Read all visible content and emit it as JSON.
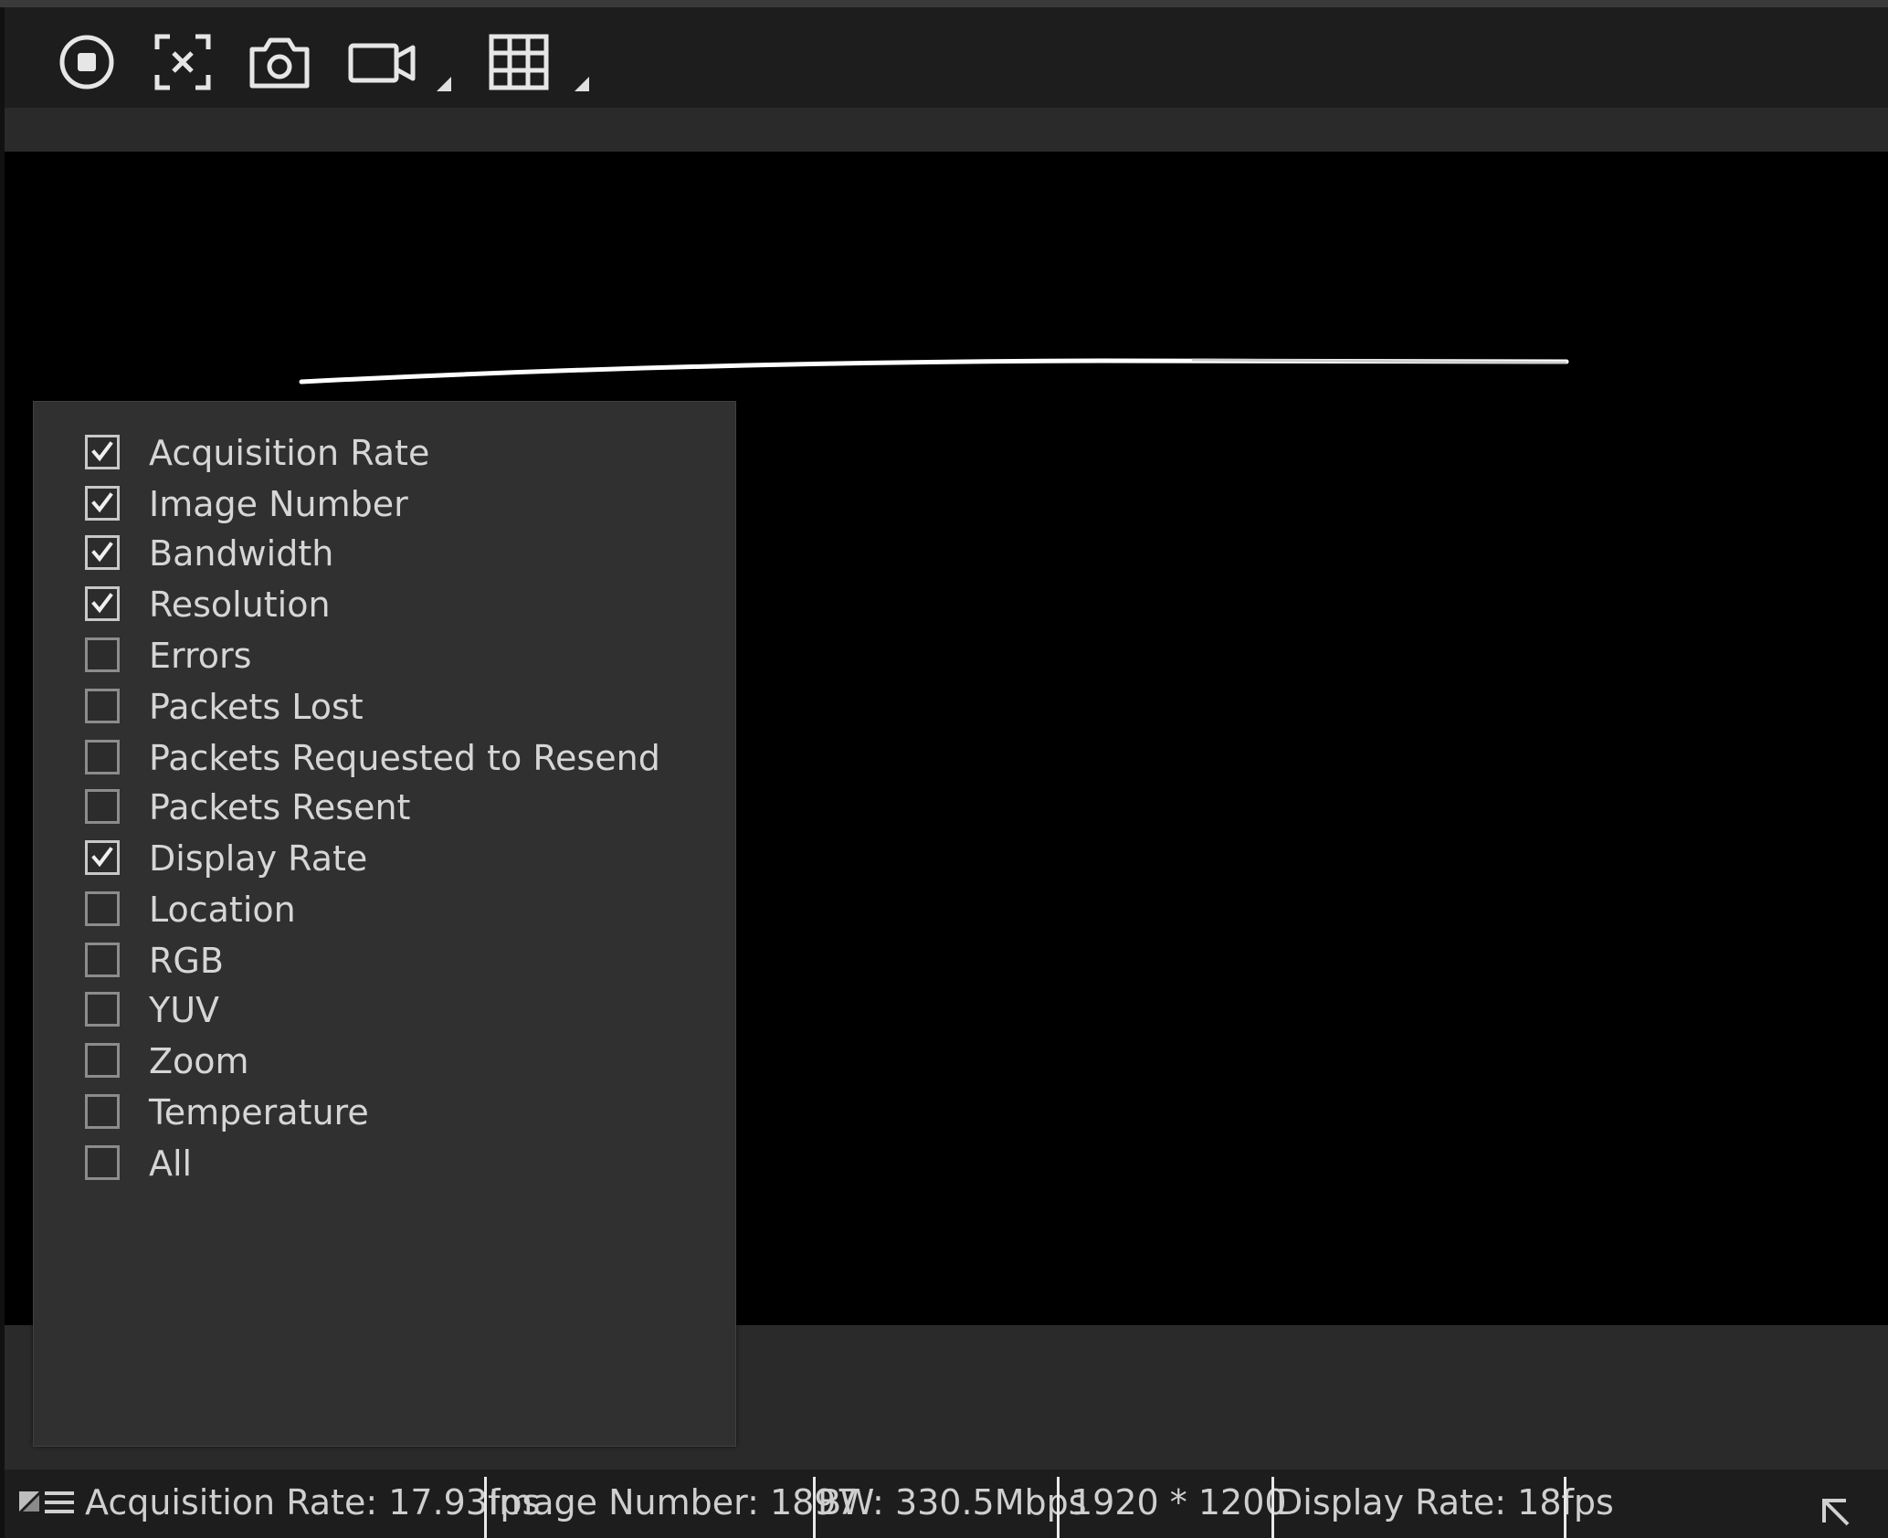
{
  "toolbar": {
    "icons": [
      "stop-icon",
      "fit-screen-icon",
      "camera-icon",
      "video-record-icon",
      "grid-layout-icon"
    ]
  },
  "overlay_menu": {
    "items": [
      {
        "label": "Acquisition Rate",
        "checked": true
      },
      {
        "label": "Image Number",
        "checked": true
      },
      {
        "label": "Bandwidth",
        "checked": true
      },
      {
        "label": "Resolution",
        "checked": true
      },
      {
        "label": "Errors",
        "checked": false
      },
      {
        "label": "Packets Lost",
        "checked": false
      },
      {
        "label": "Packets Requested to Resend",
        "checked": false
      },
      {
        "label": "Packets Resent",
        "checked": false
      },
      {
        "label": "Display Rate",
        "checked": true
      },
      {
        "label": "Location",
        "checked": false
      },
      {
        "label": "RGB",
        "checked": false
      },
      {
        "label": "YUV",
        "checked": false
      },
      {
        "label": "Zoom",
        "checked": false
      },
      {
        "label": "Temperature",
        "checked": false
      },
      {
        "label": "All",
        "checked": false
      }
    ]
  },
  "statusbar": {
    "acquisition_rate": "Acquisition Rate: 17.93fps",
    "image_number": "Image Number: 1897",
    "bandwidth": "BW: 330.5Mbps",
    "resolution": "1920 * 1200",
    "display_rate": "Display Rate: 18fps"
  },
  "colors": {
    "background": "#1b1b1b",
    "viewport": "#000000",
    "menu": "#303030",
    "text": "#d6d6d6"
  }
}
